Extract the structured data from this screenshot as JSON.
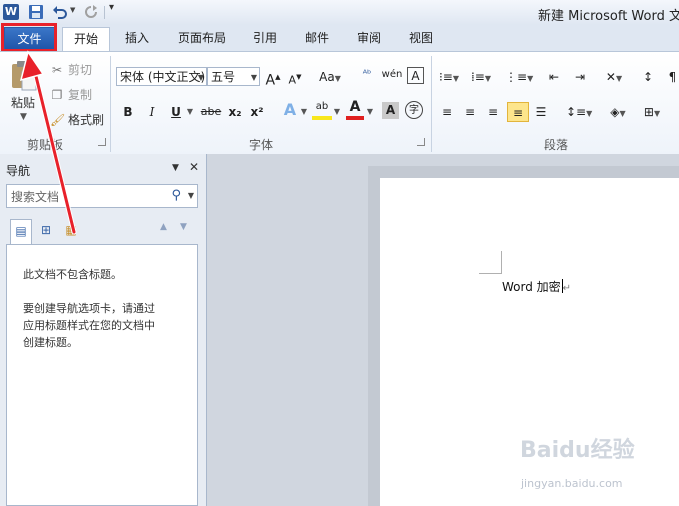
{
  "window": {
    "app_logo": "W",
    "title": "新建 Microsoft Word 文档"
  },
  "quick_access": {
    "icons": [
      "word-logo-icon",
      "save-icon",
      "undo-icon",
      "redo-icon",
      "customize-arrow-icon"
    ]
  },
  "tabs": {
    "file": "文件",
    "home": "开始",
    "insert": "插入",
    "page_layout": "页面布局",
    "references": "引用",
    "mailings": "邮件",
    "review": "审阅",
    "view": "视图"
  },
  "ribbon": {
    "clipboard": {
      "label": "剪贴板",
      "paste": "粘贴",
      "cut": "剪切",
      "copy": "复制",
      "format_painter": "格式刷"
    },
    "font": {
      "label": "字体",
      "font_name": "宋体 (中文正文)",
      "font_size": "五号",
      "bold": "B",
      "italic": "I",
      "underline": "U",
      "strikethrough": "abe",
      "subscript": "x₂",
      "superscript": "x²",
      "clear_format": "Aa",
      "phonetic": "wén",
      "char_border": "A",
      "grow": "A",
      "shrink": "A"
    },
    "paragraph": {
      "label": "段落",
      "active_alignment": "justify"
    }
  },
  "navigation": {
    "title": "导航",
    "search_placeholder": "搜索文档",
    "message_line1": "此文档不包含标题。",
    "message_line2": "要创建导航选项卡，请通过",
    "message_line3": "应用标题样式在您的文档中",
    "message_line4": "创建标题。"
  },
  "document": {
    "text": "Word 加密"
  },
  "watermark": {
    "logo": "Baidu经验",
    "url": "jingyan.baidu.com"
  },
  "colors": {
    "file_tab": "#2b5faa",
    "highlight": "#e8212a",
    "selected_button": "#fde58c"
  }
}
